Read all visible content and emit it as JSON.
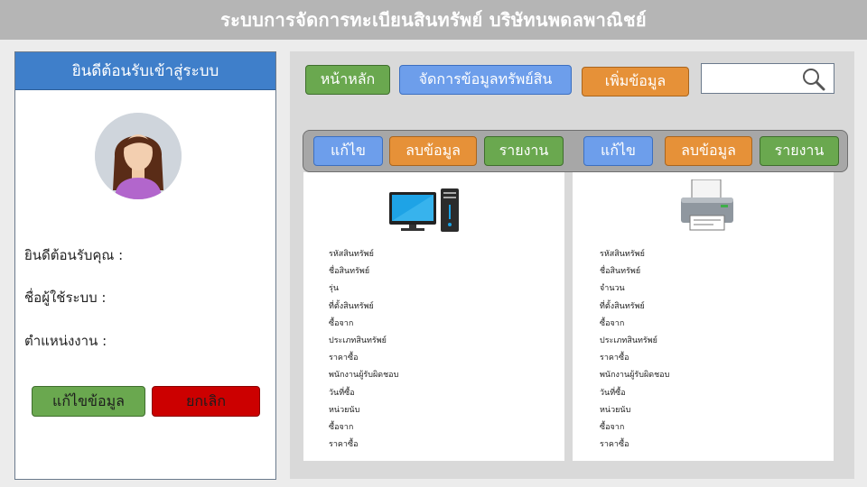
{
  "app": {
    "title": "ระบบการจัดการทะเบียนสินทรัพย์ บริษัทนพดลพาณิชย์"
  },
  "user_panel": {
    "header": "ยินดีต้อนรับเข้าสู่ระบบ",
    "welcome_label": "ยินดีต้อนรับคุณ :",
    "username_label": "ชื่อผู้ใช้ระบบ :",
    "position_label": "ตำแหน่งงาน :",
    "edit_button": "แก้ไขข้อมูล",
    "cancel_button": "ยกเลิก"
  },
  "nav": {
    "home": "หน้าหลัก",
    "manage_assets": "จัดการข้อมูลทรัพย์สิน",
    "add_data": "เพิ่มข้อมูล",
    "search_placeholder": ""
  },
  "cards": [
    {
      "icon": "computer-icon",
      "edit": "แก้ไข",
      "delete": "ลบข้อมูล",
      "report": "รายงาน",
      "fields": [
        "รหัสสินทรัพย์",
        "ชื่อสินทรัพย์",
        "รุ่น",
        "ที่ตั้งสินทรัพย์",
        "ซื้อจาก",
        "ประเภทสินทรัพย์",
        "ราคาซื้อ",
        "พนักงานผู้รับผิดชอบ",
        "วันที่ซื้อ",
        "หน่วยนับ",
        "ซื้อจาก",
        "ราคาซื้อ"
      ]
    },
    {
      "icon": "printer-icon",
      "edit": "แก้ไข",
      "delete": "ลบข้อมูล",
      "report": "รายงาน",
      "fields": [
        "รหัสสินทรัพย์",
        "ชื่อสินทรัพย์",
        "จำนวน",
        "ที่ตั้งสินทรัพย์",
        "ซื้อจาก",
        "ประเภทสินทรัพย์",
        "ราคาซื้อ",
        "พนักงานผู้รับผิดชอบ",
        "วันที่ซื้อ",
        "หน่วยนับ",
        "ซื้อจาก",
        "ราคาซื้อ"
      ]
    }
  ],
  "colors": {
    "header_blue": "#3f7fca",
    "green": "#6aa84f",
    "red": "#cc0000",
    "blue": "#6d9eeb",
    "orange": "#e69138",
    "title_bar": "#b5b5b5"
  }
}
